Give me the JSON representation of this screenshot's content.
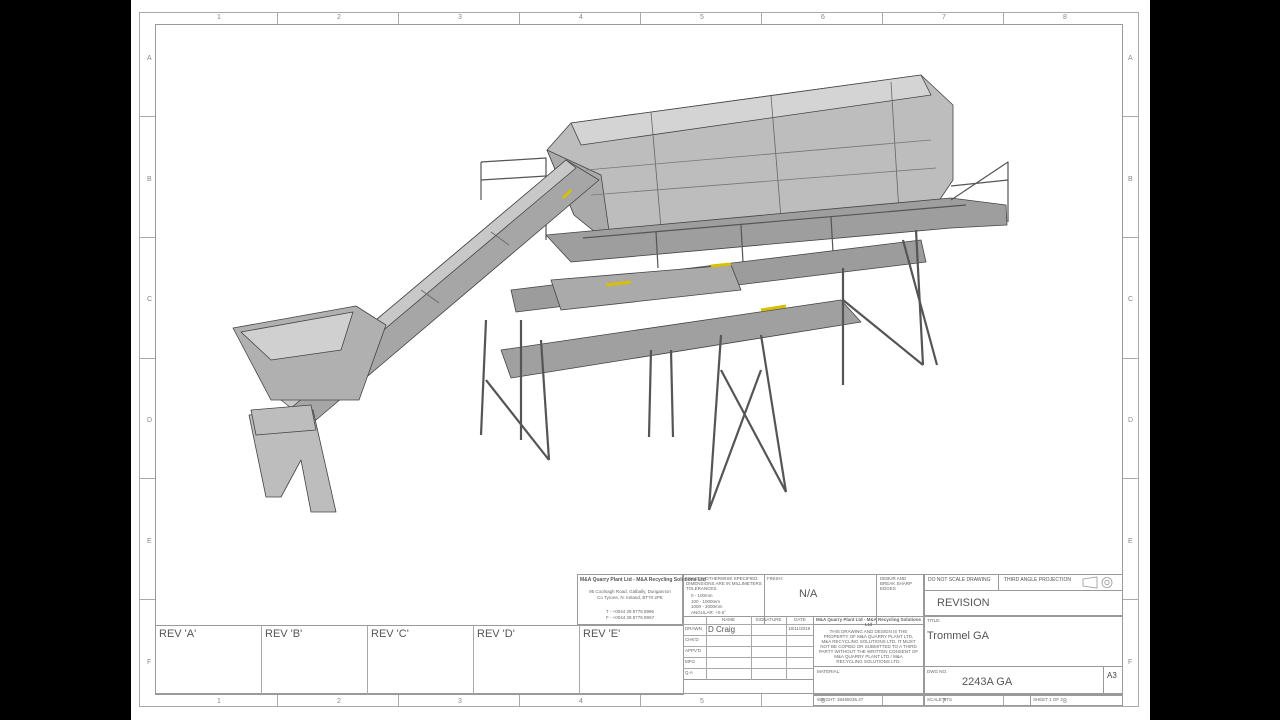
{
  "sheet": {
    "zones_top": [
      "1",
      "2",
      "3",
      "4",
      "5",
      "6",
      "7",
      "8"
    ],
    "zones_bottom": [
      "1",
      "2",
      "3",
      "4",
      "5",
      "6",
      "7",
      "8"
    ],
    "zones_left": [
      "A",
      "B",
      "C",
      "D",
      "E",
      "F"
    ],
    "zones_right": [
      "A",
      "B",
      "C",
      "D",
      "E",
      "F"
    ]
  },
  "revisions": [
    "REV 'A'",
    "REV 'B'",
    "REV 'C'",
    "REV 'D'",
    "REV 'E'"
  ],
  "company": {
    "name": "M&A Quarry Plant Ltd - M&A Recycling Solutions Ltd",
    "address_1": "95 Coolnagh Road, Galbally, Dungannon",
    "address_2": "Co Tyrone, N. Ireland, BT70 2PE",
    "phone": "T - +0044 28 8775 8996",
    "fax": "F - +0044 28 8775 8957"
  },
  "tolerances": {
    "heading": "UNLESS OTHERWISE SPECIFIED: DIMENSIONS ARE IN MILLIMETERS TOLERANCES:",
    "lines": [
      "0 - 100mm",
      "100 - 1000mm",
      "1000 - 2000mm",
      "ANGULAR: +0.5°"
    ]
  },
  "finish": {
    "label": "FINISH:",
    "value": "N/A"
  },
  "deburr": "DEBUR AND BREAK SHARP EDGES",
  "notice": "DO NOT SCALE DRAWING",
  "projection": "THIRD ANGLE PROJECTION",
  "revision": {
    "label": "REVISION"
  },
  "sign_headers": [
    "",
    "NAME",
    "SIGNATURE",
    "DATE"
  ],
  "sign_rows": [
    {
      "role": "DRAWN",
      "name": "D Craig",
      "date": "18/11/2019"
    },
    {
      "role": "CHK'D",
      "name": "",
      "date": ""
    },
    {
      "role": "APPV'D",
      "name": "",
      "date": ""
    },
    {
      "role": "MFG",
      "name": "",
      "date": ""
    },
    {
      "role": "Q.A",
      "name": "",
      "date": ""
    }
  ],
  "copyright": {
    "title": "M&A Quarry Plant Ltd - M&A Recycling Solutions Ltd",
    "lines": [
      "THIS DRAWING AND DESIGN IS THE",
      "PROPERTY OF M&A QUARRY PLANT LTD,",
      "M&A RECYCLING SOLUTIONS LTD. IT MUST",
      "NOT BE COPIED OR SUBMITTED TO A THIRD",
      "PARTY WITHOUT THE WRITTEN CONSENT OF",
      "M&A QUARRY PLANT LTD / M&A",
      "RECYCLING SOLUTIONS LTD."
    ]
  },
  "title_block": {
    "title_label": "TITLE:",
    "title": "Trommel GA",
    "material_label": "MATERIAL:",
    "dwg_label": "DWG NO.",
    "dwg_no": "2243A GA",
    "size": "A3",
    "weight_label": "WEIGHT: 38495036.47",
    "scale_label": "SCALE:NTS",
    "sheet_label": "SHEET 1 OF 2"
  }
}
